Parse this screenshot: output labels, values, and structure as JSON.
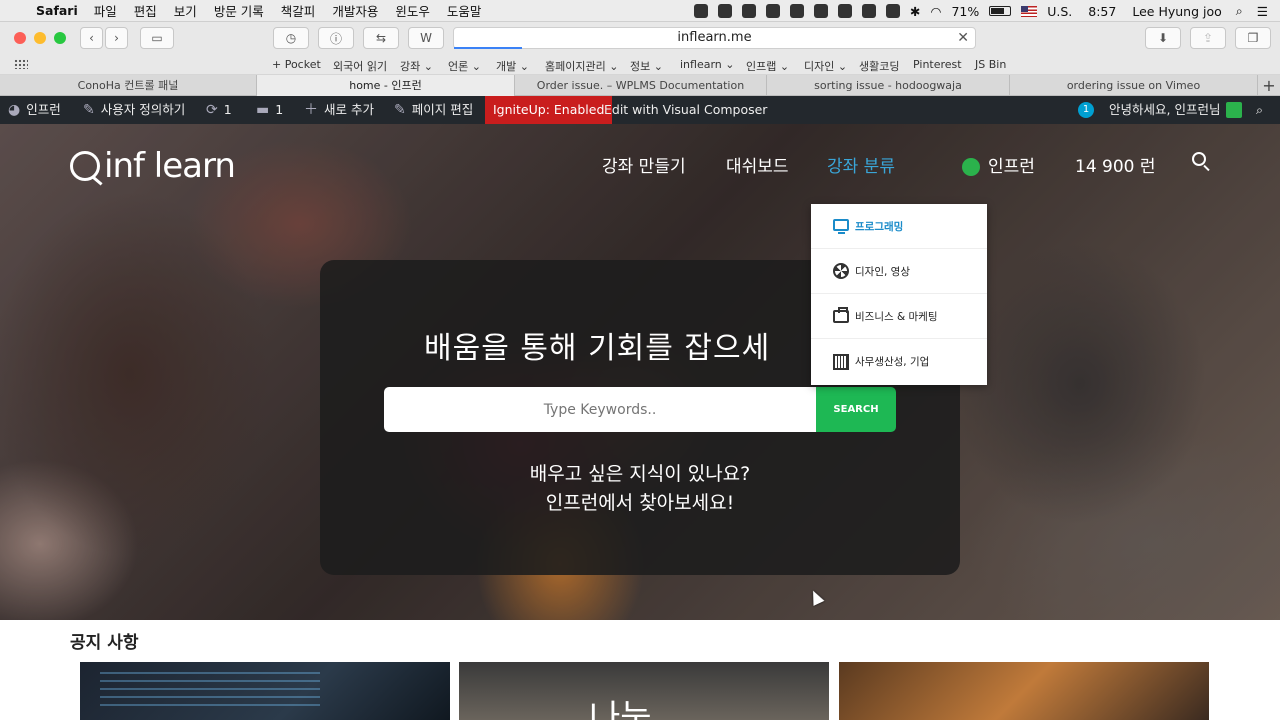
{
  "menubar": {
    "app": "Safari",
    "items": [
      "파일",
      "편집",
      "보기",
      "방문 기록",
      "책갈피",
      "개발자용",
      "윈도우",
      "도움말"
    ],
    "battery": "71%",
    "input_source": "U.S.",
    "time": "8:57",
    "user": "Lee Hyung joo"
  },
  "toolbar": {
    "url": "inflearn.me",
    "reader_label": "W"
  },
  "bookmarks": [
    "+ Pocket",
    "외국어 읽기",
    "강좌 ⌄",
    "언론 ⌄",
    "개발 ⌄",
    "홈페이지관리 ⌄",
    "정보 ⌄",
    "inflearn ⌄",
    "인프랩 ⌄",
    "디자인 ⌄",
    "생활코딩",
    "Pinterest",
    "JS Bin"
  ],
  "tabs": [
    {
      "title": "ConoHa 컨트롤 패널"
    },
    {
      "title": "home - 인프런"
    },
    {
      "title": "Order issue. – WPLMS Documentation"
    },
    {
      "title": "sorting issue - hodoogwaja"
    },
    {
      "title": "ordering issue on Vimeo"
    }
  ],
  "wp_admin": {
    "site": "인프런",
    "customize": "사용자 정의하기",
    "updates": "1",
    "comments": "1",
    "new": "새로 추가",
    "edit_page": "페이지 편집",
    "ignite": "IgniteUp: Enabled",
    "visual_composer": "Edit with Visual Composer",
    "notif_count": "1",
    "greeting": "안녕하세요, 인프런님"
  },
  "site": {
    "logo": "inf learn",
    "nav": [
      "강좌 만들기",
      "대쉬보드",
      "강좌 분류"
    ],
    "active_nav": "강좌 분류",
    "user_name": "인프런",
    "points": "14 900 런",
    "headline": "배움을 통해 기회를 잡으세",
    "search_placeholder": "Type Keywords..",
    "search_button": "SEARCH",
    "sub1": "배우고 싶은 지식이 있나요?",
    "sub2": "인프런에서 찾아보세요!",
    "notice_title": "공지 사항",
    "card2_text": "나눔"
  },
  "dropdown": [
    {
      "label": "프로그래밍",
      "icon": "monitor-icon",
      "selected": true
    },
    {
      "label": "디자인, 영상",
      "icon": "aperture-icon",
      "selected": false
    },
    {
      "label": "비즈니스 & 마케팅",
      "icon": "briefcase-icon",
      "selected": false
    },
    {
      "label": "사무생산성, 기업",
      "icon": "calculator-icon",
      "selected": false
    }
  ],
  "colors": {
    "accent": "#3aa6d8",
    "search_green": "#1eb854",
    "ignite_red": "#c91d1d",
    "wp_bar": "#23282d"
  }
}
